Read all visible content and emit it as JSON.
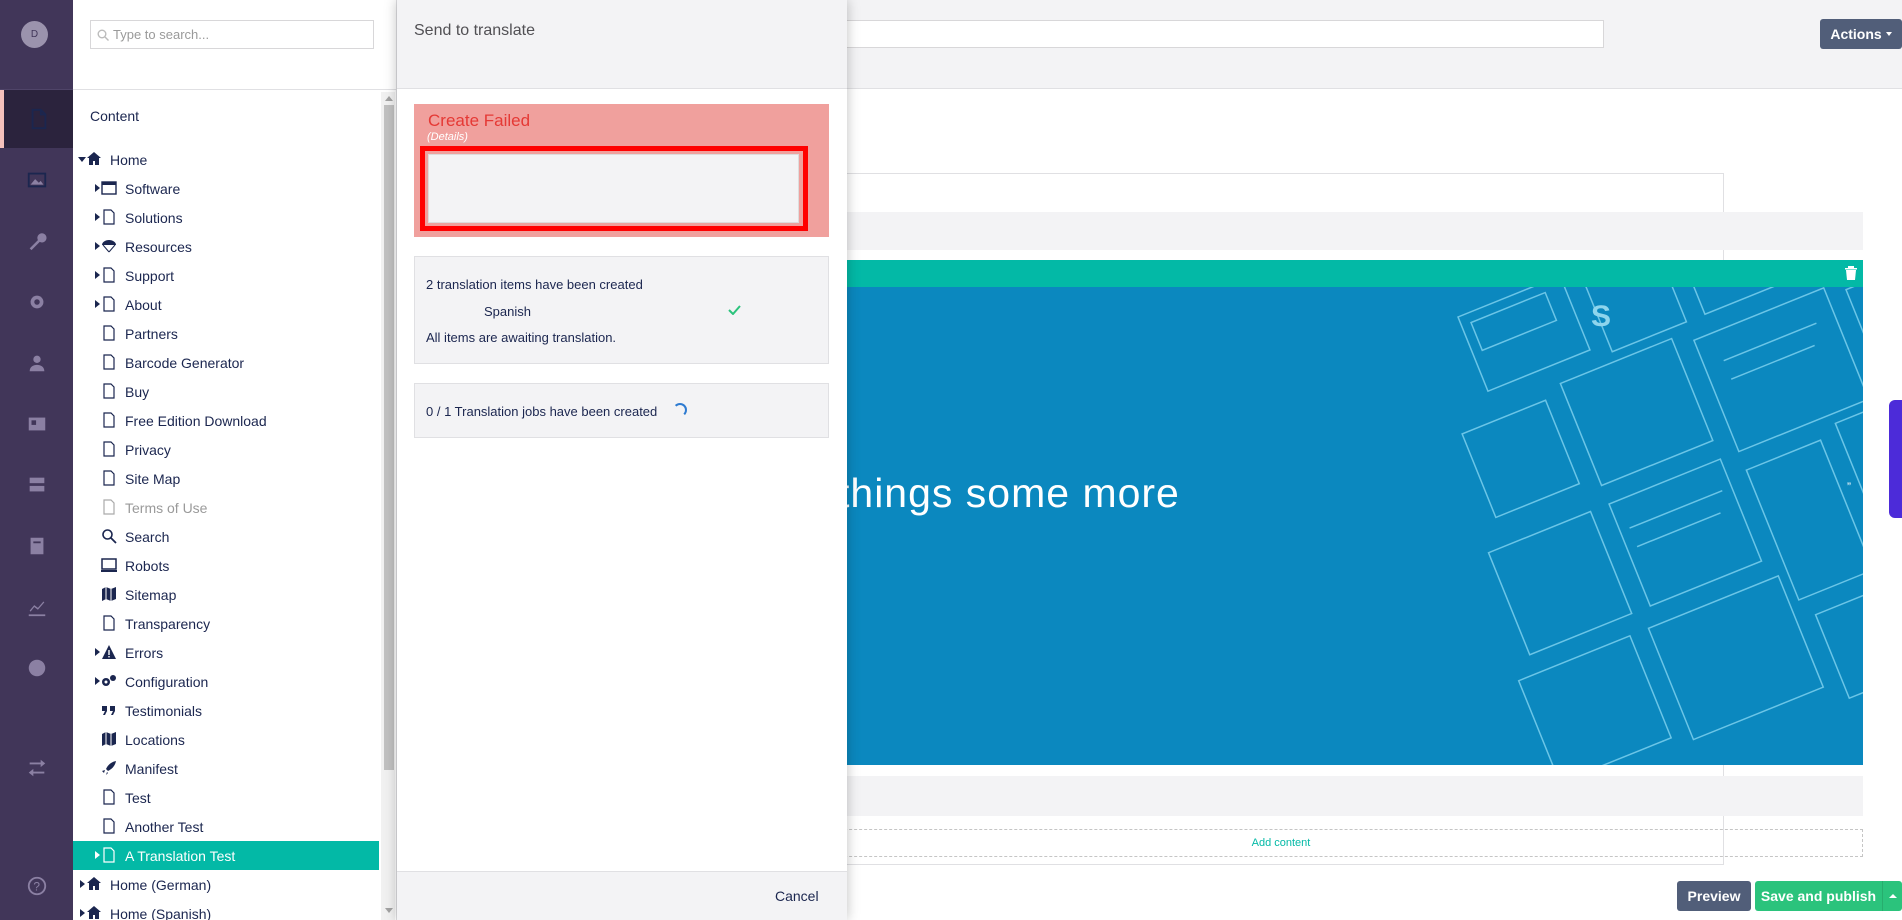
{
  "user": {
    "avatar_initial": "D"
  },
  "nav_sections": [
    "content-icon",
    "media-icon",
    "settings-wrench-icon",
    "settings-gear-icon",
    "users-icon",
    "members-icon",
    "forms-icon",
    "translation-icon",
    "analytics-icon",
    "globe-icon",
    "deploy-icon"
  ],
  "tree": {
    "search_placeholder": "Type to search...",
    "section_title": "Content",
    "items": [
      {
        "label": "Home",
        "icon": "home-icon",
        "expanded": true,
        "level": 0
      },
      {
        "label": "Software",
        "icon": "window-icon",
        "has_children": true,
        "level": 1
      },
      {
        "label": "Solutions",
        "icon": "document-icon",
        "has_children": true,
        "level": 1
      },
      {
        "label": "Resources",
        "icon": "parachute-icon",
        "has_children": true,
        "level": 1
      },
      {
        "label": "Support",
        "icon": "document-icon",
        "has_children": true,
        "level": 1
      },
      {
        "label": "About",
        "icon": "document-icon",
        "has_children": true,
        "level": 1
      },
      {
        "label": "Partners",
        "icon": "document-icon",
        "level": 1
      },
      {
        "label": "Barcode Generator",
        "icon": "document-icon",
        "level": 1
      },
      {
        "label": "Buy",
        "icon": "document-icon",
        "level": 1
      },
      {
        "label": "Free Edition Download",
        "icon": "document-icon",
        "level": 1
      },
      {
        "label": "Privacy",
        "icon": "document-icon",
        "level": 1
      },
      {
        "label": "Site Map",
        "icon": "document-icon",
        "level": 1
      },
      {
        "label": "Terms of Use",
        "icon": "document-icon",
        "level": 1,
        "muted": true
      },
      {
        "label": "Search",
        "icon": "search-icon",
        "level": 1
      },
      {
        "label": "Robots",
        "icon": "monitor-icon",
        "level": 1
      },
      {
        "label": "Sitemap",
        "icon": "map-icon",
        "level": 1
      },
      {
        "label": "Transparency",
        "icon": "document-icon",
        "level": 1
      },
      {
        "label": "Errors",
        "icon": "warning-icon",
        "has_children": true,
        "level": 1
      },
      {
        "label": "Configuration",
        "icon": "cogs-icon",
        "has_children": true,
        "level": 1
      },
      {
        "label": "Testimonials",
        "icon": "quote-icon",
        "level": 1
      },
      {
        "label": "Locations",
        "icon": "map-icon",
        "level": 1
      },
      {
        "label": "Manifest",
        "icon": "rocket-icon",
        "level": 1
      },
      {
        "label": "Test",
        "icon": "document-icon",
        "level": 1
      },
      {
        "label": "Another Test",
        "icon": "document-icon",
        "level": 1
      },
      {
        "label": "A Translation Test",
        "icon": "document-icon",
        "has_children": true,
        "level": 1,
        "selected": true
      },
      {
        "label": "Home (German)",
        "icon": "home-icon",
        "has_children": true,
        "level": 0
      },
      {
        "label": "Home (Spanish)",
        "icon": "home-icon",
        "has_children": true,
        "level": 0
      }
    ]
  },
  "dialog": {
    "title": "Send to translate",
    "error_title": "Create Failed",
    "error_details_link": "(Details)",
    "items_created": "2 translation items have been created",
    "language": "Spanish",
    "awaiting": "All items are awaiting translation.",
    "jobs_created": "0 / 1 Translation jobs have been created",
    "cancel_label": "Cancel"
  },
  "editor": {
    "actions_label": "Actions",
    "hero_text": "things some more",
    "add_content_label": "Add content",
    "preview_label": "Preview",
    "save_publish_label": "Save and publish",
    "quote_glyph": "”"
  },
  "colors": {
    "nav": "#413659",
    "accent_teal": "#03b9a6",
    "error_bg": "#f0a09d",
    "error_text": "#e53935",
    "success": "#2bc37c",
    "hero": "#0b88bf"
  }
}
